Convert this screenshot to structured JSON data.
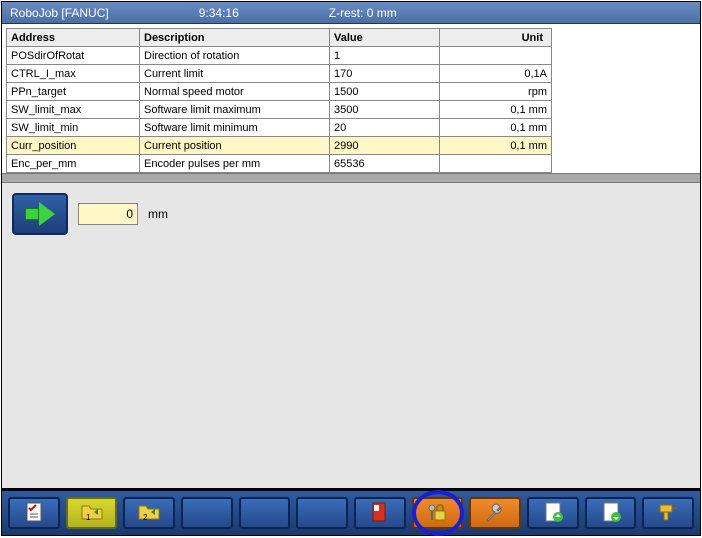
{
  "titlebar": {
    "app": "RoboJob [FANUC]",
    "time": "9:34:16",
    "zrest": "Z-rest: 0 mm"
  },
  "table": {
    "headers": {
      "addr": "Address",
      "desc": "Description",
      "val": "Value",
      "unit": "Unit"
    },
    "rows": [
      {
        "addr": "POSdirOfRotat",
        "desc": "Direction of rotation",
        "val": "1",
        "unit": "",
        "hl": false
      },
      {
        "addr": "CTRL_I_max",
        "desc": "Current limit",
        "val": "170",
        "unit": "0,1A",
        "hl": false
      },
      {
        "addr": "PPn_target",
        "desc": "Normal speed motor",
        "val": "1500",
        "unit": "rpm",
        "hl": false
      },
      {
        "addr": "SW_limit_max",
        "desc": "Software limit maximum",
        "val": "3500",
        "unit": "0,1 mm",
        "hl": false
      },
      {
        "addr": "SW_limit_min",
        "desc": "Software limit minimum",
        "val": "20",
        "unit": "0,1 mm",
        "hl": false
      },
      {
        "addr": "Curr_position",
        "desc": "Current position",
        "val": "2990",
        "unit": "0,1 mm",
        "hl": true
      },
      {
        "addr": "Enc_per_mm",
        "desc": "Encoder pulses per mm",
        "val": "65536",
        "unit": "",
        "hl": false
      }
    ]
  },
  "go": {
    "value": "0",
    "unit": "mm"
  },
  "toolbar": {
    "buttons": [
      {
        "name": "clipboard-check-icon",
        "style": "blue"
      },
      {
        "name": "folder-1-icon",
        "style": "yellow"
      },
      {
        "name": "folder-2-icon",
        "style": "blue"
      },
      {
        "name": "empty-1",
        "style": "blue"
      },
      {
        "name": "empty-2",
        "style": "blue"
      },
      {
        "name": "empty-3",
        "style": "blue"
      },
      {
        "name": "book-icon",
        "style": "blue"
      },
      {
        "name": "lock-keys-icon",
        "style": "orange",
        "circled": true
      },
      {
        "name": "wrench-icon",
        "style": "orange"
      },
      {
        "name": "page-up-icon",
        "style": "blue"
      },
      {
        "name": "page-down-icon",
        "style": "blue"
      },
      {
        "name": "drill-icon",
        "style": "blue"
      }
    ]
  }
}
